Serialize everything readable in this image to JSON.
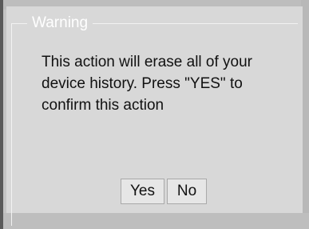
{
  "dialog": {
    "title": "Warning",
    "message": "This action will erase all of your device history. Press \"YES\" to confirm this action",
    "buttons": {
      "yes": "Yes",
      "no": "No"
    }
  }
}
